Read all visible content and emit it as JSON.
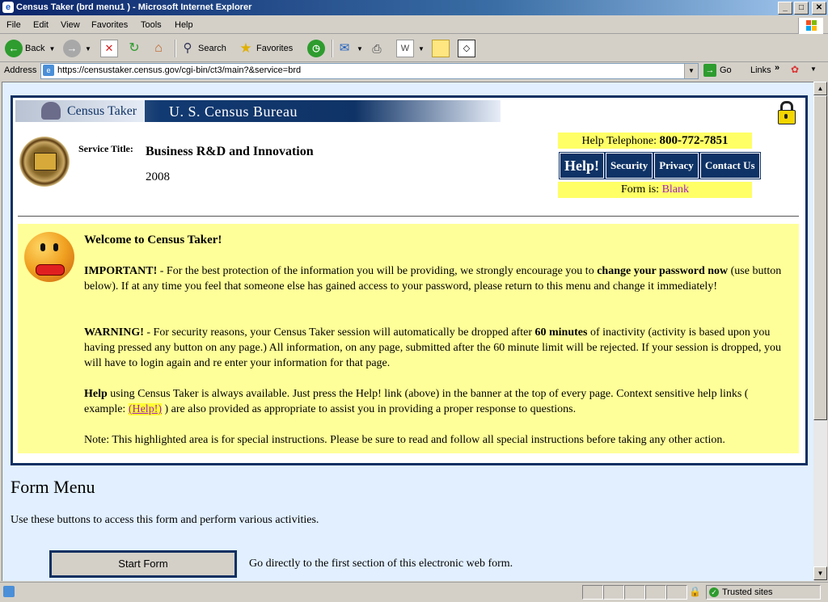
{
  "window": {
    "title": "Census Taker (brd menu1 ) - Microsoft Internet Explorer",
    "controls": [
      "_",
      "□",
      "✕"
    ]
  },
  "menu": [
    "File",
    "Edit",
    "View",
    "Favorites",
    "Tools",
    "Help"
  ],
  "toolbar": {
    "back": "Back",
    "search": "Search",
    "favorites": "Favorites"
  },
  "address": {
    "label": "Address",
    "url": "https://censustaker.census.gov/cgi-bin/ct3/main?&service=brd",
    "go": "Go",
    "links": "Links"
  },
  "banner": {
    "product": "Census Taker",
    "bureau": "U. S. Census Bureau"
  },
  "service": {
    "label": "Service Title:",
    "title": "Business R&D and Innovation",
    "year": "2008"
  },
  "help_panel": {
    "telephone_label": "Help Telephone:",
    "telephone": "800-772-7851",
    "buttons": [
      "Help!",
      "Security",
      "Privacy",
      "Contact Us"
    ],
    "form_is_label": "Form is:",
    "form_is_value": "Blank"
  },
  "notice": {
    "heading": "Welcome to Census Taker!",
    "important_label": "IMPORTANT!",
    "important_text_1": " - For the best protection of the information you will be providing, we strongly encourage you to ",
    "important_bold": "change your password now",
    "important_text_2": " (use button below). If at any time you feel that someone else has gained access to your password, please return to this menu and change it immediately!",
    "warning_label": "WARNING!",
    "warning_text_1": " - For security reasons, your Census Taker session will automatically be dropped after ",
    "warning_bold": "60 minutes",
    "warning_text_2": " of inactivity (activity is based upon you having pressed any button on any page.) All information, on any page, submitted after the 60 minute limit will be rejected. If your session is dropped, you will have to login again and re enter your information for that page.",
    "help_label": "Help",
    "help_text_1": " using Census Taker is always available. Just press the Help! link (above) in the banner at the top of every page. Context sensitive help links ( example: ",
    "help_link": "(Help!)",
    "help_text_2": " ) are also provided as appropriate to assist you in providing a proper response to questions.",
    "note": "Note: This highlighted area is for special instructions. Please be sure to read and follow all special instructions before taking any other action."
  },
  "form_menu": {
    "title": "Form Menu",
    "description": "Use these buttons to access this form and perform various activities.",
    "start_button": "Start Form",
    "start_description": "Go directly to the first section of this electronic web form."
  },
  "status": {
    "zone": "Trusted sites"
  }
}
